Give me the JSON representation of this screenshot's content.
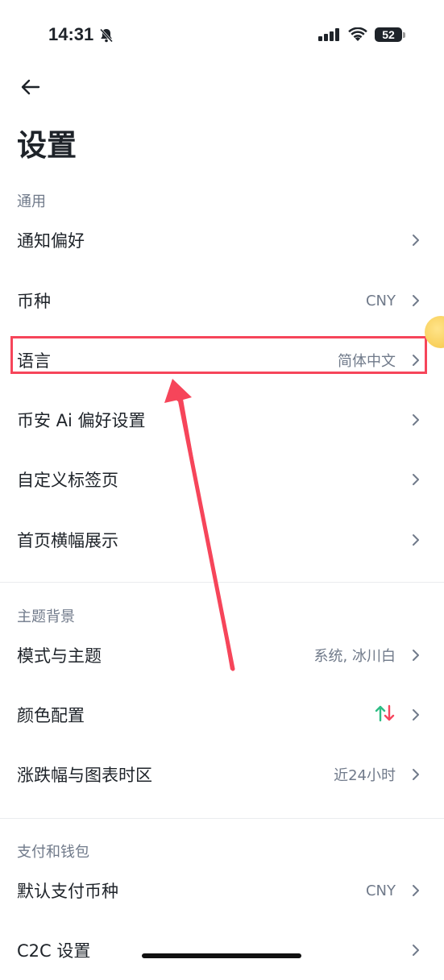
{
  "status_bar": {
    "time": "14:31",
    "battery": "52"
  },
  "page": {
    "title": "设置"
  },
  "sections": [
    {
      "label": "通用",
      "items": [
        {
          "label": "通知偏好",
          "value": ""
        },
        {
          "label": "币种",
          "value": "CNY"
        },
        {
          "label": "语言",
          "value": "简体中文"
        },
        {
          "label": "币安 Ai 偏好设置",
          "value": ""
        },
        {
          "label": "自定义标签页",
          "value": ""
        },
        {
          "label": "首页横幅展示",
          "value": ""
        }
      ]
    },
    {
      "label": "主题背景",
      "items": [
        {
          "label": "模式与主题",
          "value": "系统, 冰川白"
        },
        {
          "label": "颜色配置",
          "value_icon": "up-down-arrows-icon"
        },
        {
          "label": "涨跌幅与图表时区",
          "value": "近24小时"
        }
      ]
    },
    {
      "label": "支付和钱包",
      "items": [
        {
          "label": "默认支付币种",
          "value": "CNY"
        },
        {
          "label": "C2C 设置",
          "value": ""
        }
      ]
    }
  ],
  "colors": {
    "highlight": "#f6455a",
    "up": "#2ebd85",
    "down": "#f6465d"
  }
}
